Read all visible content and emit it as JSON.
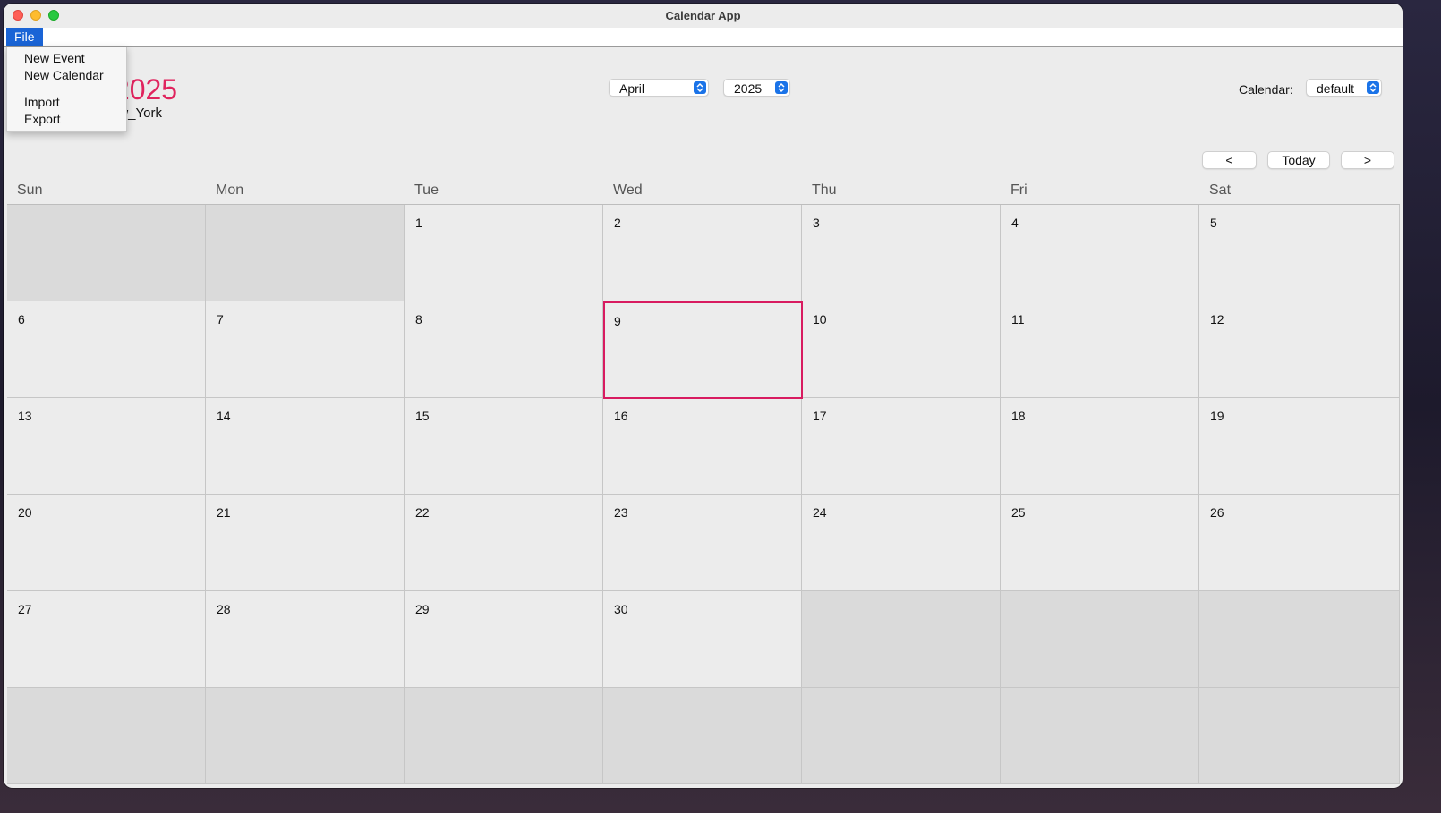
{
  "window": {
    "title": "Calendar App"
  },
  "menubar": {
    "file_label": "File"
  },
  "file_menu": {
    "items": [
      "New Event",
      "New Calendar",
      "Import",
      "Export"
    ]
  },
  "header": {
    "month_year": "April 2025",
    "timezone": "America/New_York",
    "month_select": "April",
    "year_select": "2025",
    "calendar_label": "Calendar:",
    "calendar_select": "default"
  },
  "nav": {
    "prev": "<",
    "today": "Today",
    "next": ">"
  },
  "weekdays": [
    "Sun",
    "Mon",
    "Tue",
    "Wed",
    "Thu",
    "Fri",
    "Sat"
  ],
  "calendar": {
    "first_weekday_index": 2,
    "days_in_month": 30,
    "rows": 6,
    "selected_day": 9
  },
  "colors": {
    "accent": "#e0245e",
    "selected_border": "#d81b60",
    "menu_highlight": "#1a64d6",
    "select_arrow": "#1a73e8"
  }
}
